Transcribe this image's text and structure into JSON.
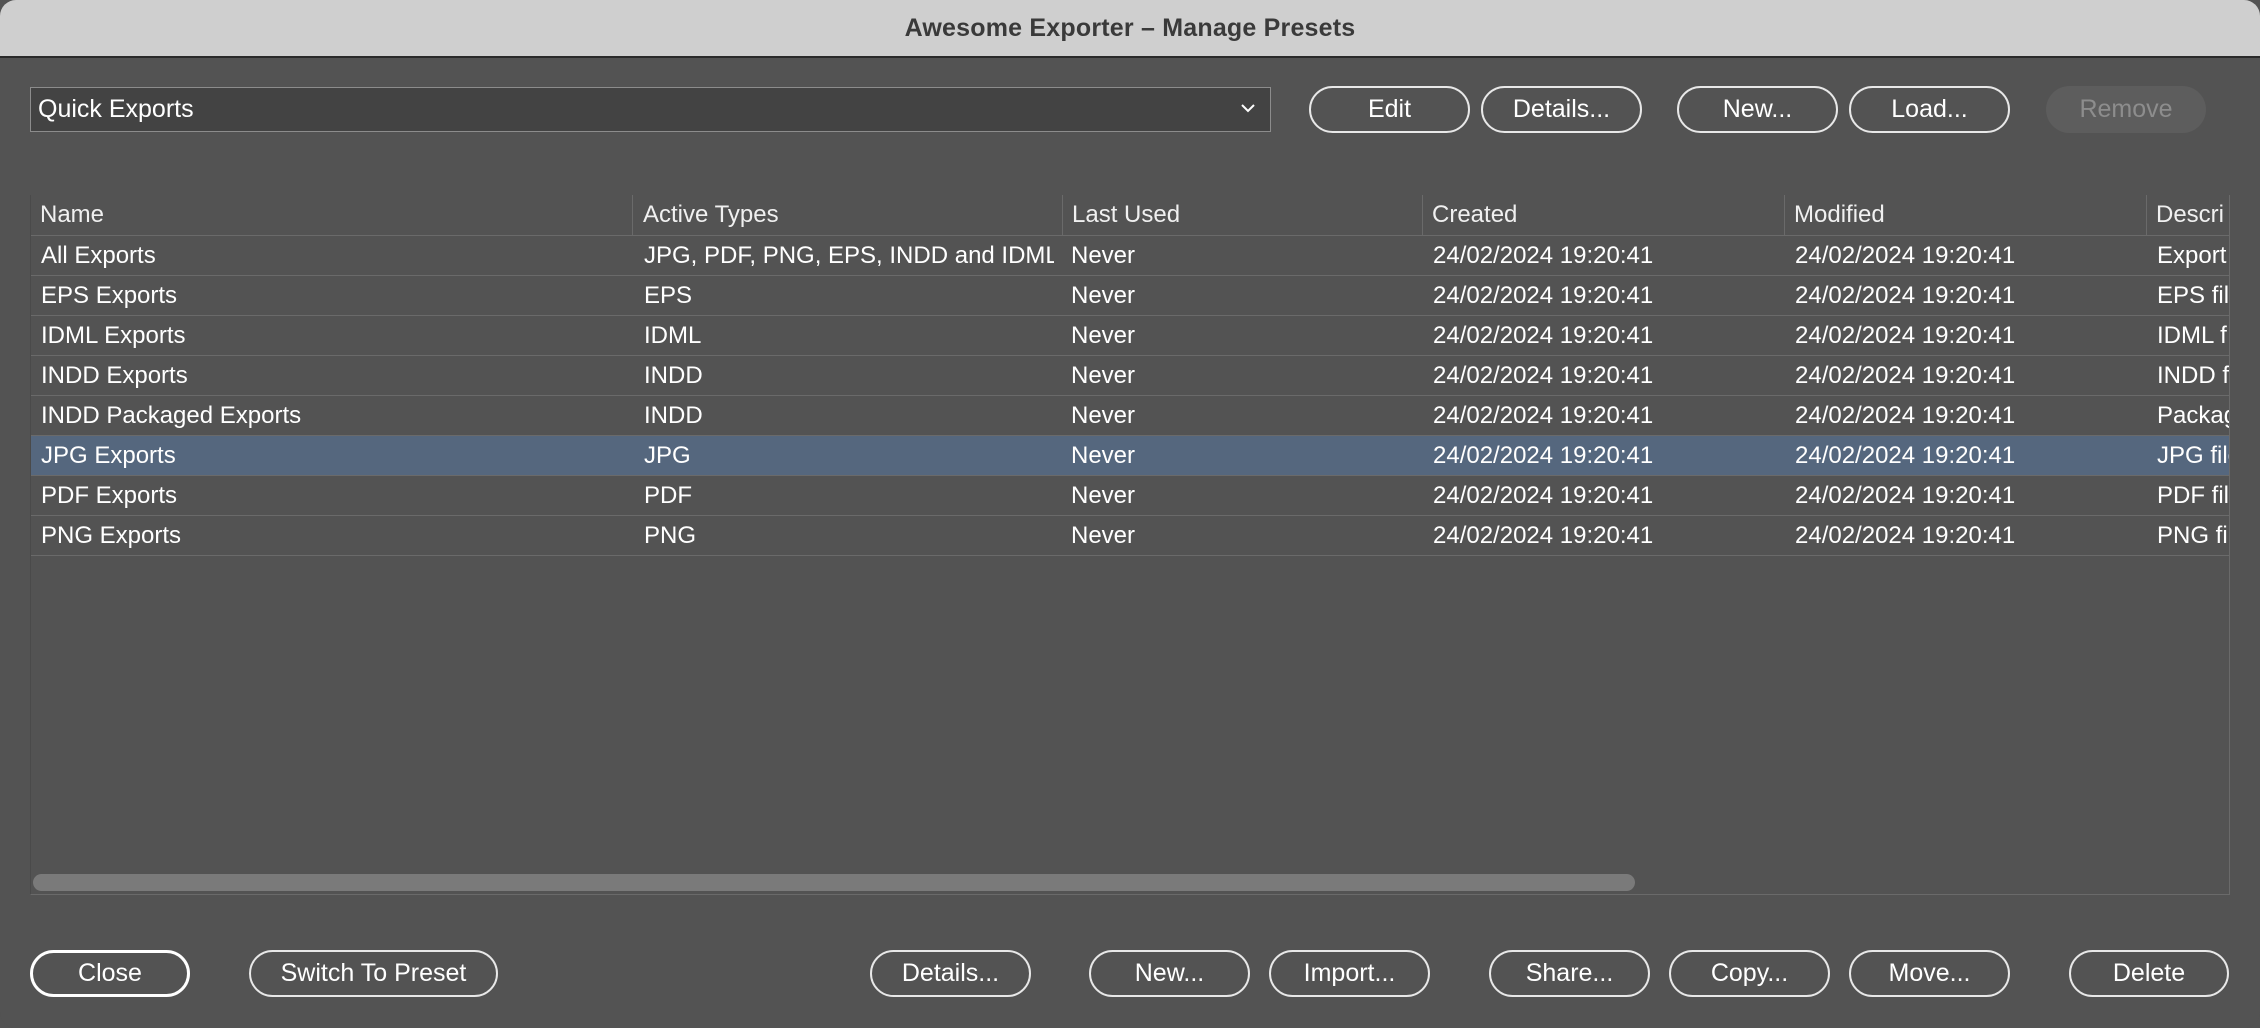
{
  "window": {
    "title": "Awesome Exporter – Manage Presets"
  },
  "preset_group": {
    "selected": "Quick Exports"
  },
  "top_buttons": {
    "edit": "Edit",
    "details": "Details...",
    "new": "New...",
    "load": "Load...",
    "remove": "Remove"
  },
  "table": {
    "columns": [
      "Name",
      "Active Types",
      "Last Used",
      "Created",
      "Modified",
      "Descri"
    ],
    "rows": [
      [
        "All Exports",
        "JPG, PDF, PNG, EPS, INDD and IDML",
        "Never",
        "24/02/2024 19:20:41",
        "24/02/2024 19:20:41",
        "Export"
      ],
      [
        "EPS Exports",
        "EPS",
        "Never",
        "24/02/2024 19:20:41",
        "24/02/2024 19:20:41",
        "EPS file"
      ],
      [
        "IDML Exports",
        "IDML",
        "Never",
        "24/02/2024 19:20:41",
        "24/02/2024 19:20:41",
        "IDML f"
      ],
      [
        "INDD Exports",
        "INDD",
        "Never",
        "24/02/2024 19:20:41",
        "24/02/2024 19:20:41",
        "INDD f"
      ],
      [
        "INDD Packaged Exports",
        "INDD",
        "Never",
        "24/02/2024 19:20:41",
        "24/02/2024 19:20:41",
        "Packag"
      ],
      [
        "JPG Exports",
        "JPG",
        "Never",
        "24/02/2024 19:20:41",
        "24/02/2024 19:20:41",
        "JPG file"
      ],
      [
        "PDF Exports",
        "PDF",
        "Never",
        "24/02/2024 19:20:41",
        "24/02/2024 19:20:41",
        "PDF fil"
      ],
      [
        "PNG Exports",
        "PNG",
        "Never",
        "24/02/2024 19:20:41",
        "24/02/2024 19:20:41",
        "PNG fi"
      ]
    ],
    "selected_row": "JPG Exports"
  },
  "bottom_buttons": {
    "close": "Close",
    "switch": "Switch To Preset",
    "details": "Details...",
    "new": "New...",
    "import": "Import...",
    "share": "Share...",
    "copy": "Copy...",
    "move": "Move...",
    "delete": "Delete"
  },
  "colors": {
    "background": "#535353",
    "titlebar": "#cfcfcf",
    "selection": "#55677e"
  }
}
